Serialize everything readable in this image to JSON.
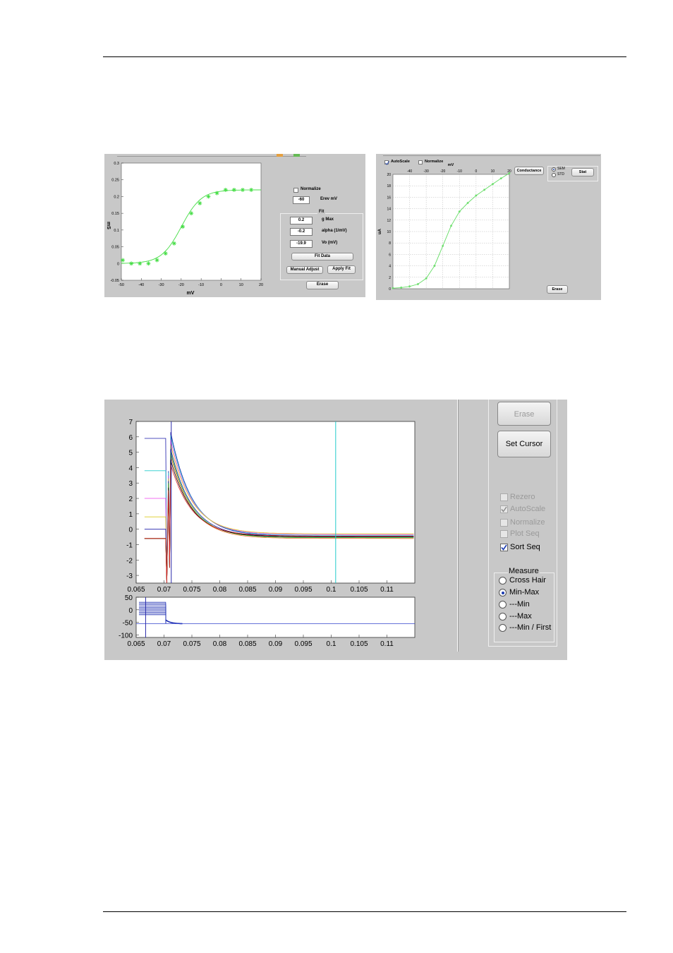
{
  "screenshot_left": {
    "chart_data": {
      "type": "scatter",
      "xlabel": "mV",
      "ylabel": "mS",
      "xlim": [
        -50,
        20
      ],
      "ylim": [
        -0.05,
        0.3
      ],
      "xticks": [
        "-50",
        "-40",
        "-30",
        "-20",
        "-10",
        "0",
        "10",
        "20",
        "30"
      ],
      "yticks": [
        "0.3",
        "0.25",
        "0.2",
        "0.15",
        "0.1",
        "0.05",
        "0",
        "-0.05"
      ],
      "series": [
        {
          "marker": "star",
          "x": [
            -50,
            -45,
            -40,
            -35,
            -30,
            -25,
            -20,
            -15,
            -10,
            -5,
            0,
            5,
            10,
            15,
            20,
            25
          ],
          "y": [
            0.01,
            0.0,
            0.0,
            0.0,
            0.01,
            0.03,
            0.06,
            0.11,
            0.15,
            0.18,
            0.2,
            0.21,
            0.22,
            0.22,
            0.22,
            0.22
          ]
        },
        {
          "marker": "line",
          "fit": true
        }
      ],
      "color": "#44dd44",
      "grid": false
    },
    "normalize_label": "Normalize",
    "erev_value": "-60",
    "erev_label": "Erev mV",
    "fit_group_title": "Fit",
    "gmax_value": "0.2",
    "gmax_label": "g Max",
    "alpha_value": "-0.2",
    "alpha_label": "alpha (1/mV)",
    "vo_value": "-19.9",
    "vo_label": "Vo (mV)",
    "fit_data_button": "Fit Data",
    "manual_adjust_button": "Manual Adjust",
    "apply_fit_button": "Apply Fit",
    "erase_button": "Erase"
  },
  "screenshot_right": {
    "autoscale_label": "AutoScale",
    "normalize_label": "Normalize",
    "chart_data": {
      "type": "line",
      "xlabel": "mV",
      "ylabel": "uA",
      "xlim": [
        -50,
        20
      ],
      "ylim": [
        0,
        20
      ],
      "xticks": [
        "-40",
        "-30",
        "-20",
        "-10",
        "0",
        "10",
        "20"
      ],
      "yticks": [
        "20",
        "18",
        "16",
        "14",
        "12",
        "10",
        "8",
        "6",
        "4",
        "2",
        "0"
      ],
      "x": [
        -50,
        -45,
        -40,
        -35,
        -30,
        -25,
        -20,
        -15,
        -10,
        -5,
        0,
        5,
        10,
        15,
        20
      ],
      "y": [
        0.1,
        0.2,
        0.4,
        0.8,
        1.8,
        4.0,
        7.5,
        11.0,
        13.5,
        15.0,
        16.3,
        17.3,
        18.3,
        19.3,
        20.2
      ],
      "color": "#66dd66",
      "grid": true,
      "axis_position": "top"
    },
    "conductance_button": "Conductance",
    "sem_label": "SEM",
    "std_label": "STD",
    "stat_button": "Stat",
    "erase_button": "Erase"
  },
  "screenshot_bottom": {
    "chart_data": [
      {
        "type": "line",
        "xlim": [
          0.065,
          0.115
        ],
        "ylim": [
          -3.5,
          7
        ],
        "xticks": [
          "0.065",
          "0.07",
          "0.075",
          "0.08",
          "0.085",
          "0.09",
          "0.095",
          "0.1",
          "0.105",
          "0.11"
        ],
        "yticks": [
          "7",
          "6",
          "5",
          "4",
          "3",
          "2",
          "1",
          "0",
          "-1",
          "-2",
          "-3"
        ],
        "series": [
          {
            "color": "#1a1aaa",
            "baseline": 5.9,
            "peak": 6.3,
            "final": -0.45
          },
          {
            "color": "#22cccc",
            "baseline": 3.8,
            "peak": 6.1,
            "final": -0.4
          },
          {
            "color": "#ee44ee",
            "baseline": 2.0,
            "peak": 5.8,
            "final": -0.35
          },
          {
            "color": "#ddcc22",
            "baseline": 0.8,
            "peak": 5.5,
            "final": -0.3
          },
          {
            "color": "#1a1aaa",
            "baseline": 0.0,
            "peak": 5.2,
            "final": -0.5
          },
          {
            "color": "#ee6622",
            "baseline": -0.6,
            "peak": 4.8,
            "final": -0.6
          },
          {
            "color": "#22bb22",
            "baseline": -0.6,
            "peak": 5.0,
            "final": -0.55
          },
          {
            "color": "#000000",
            "baseline": -0.6,
            "peak": 4.5,
            "final": -0.5
          },
          {
            "color": "#dd2222",
            "baseline": -0.6,
            "peak": 4.2,
            "final": -0.45
          }
        ],
        "cursors": [
          {
            "x": 0.0713,
            "color": "#2a2aaa"
          },
          {
            "x": 0.1008,
            "color": "#22cccc"
          }
        ],
        "grid": false
      },
      {
        "type": "line",
        "xlim": [
          0.065,
          0.115
        ],
        "ylim": [
          -110,
          50
        ],
        "xticks": [
          "0.065",
          "0.07",
          "0.075",
          "0.08",
          "0.085",
          "0.09",
          "0.095",
          "0.1",
          "0.105",
          "0.11"
        ],
        "yticks": [
          "50",
          "0",
          "-50",
          "-100"
        ],
        "step_levels": [
          30,
          25,
          20,
          15,
          10,
          5,
          0,
          -5,
          -10,
          -15,
          -20
        ],
        "holding": -55,
        "cursors": [
          {
            "x": 0.0667,
            "color": "#2a2aaa"
          }
        ],
        "color": "#1a2ab0",
        "grid": false
      }
    ],
    "erase_button": "Erase",
    "set_cursor_button": "Set Cursor",
    "checkboxes": [
      {
        "label": "Rezero",
        "checked": false,
        "enabled": false
      },
      {
        "label": "AutoScale",
        "checked": true,
        "enabled": false
      },
      {
        "label": "Normalize",
        "checked": false,
        "enabled": false
      },
      {
        "label": "Plot Seq",
        "checked": false,
        "enabled": false
      },
      {
        "label": "Sort Seq",
        "checked": true,
        "enabled": true
      }
    ],
    "measure_title": "Measure",
    "measure_options": [
      {
        "label": "Cross Hair",
        "selected": false
      },
      {
        "label": "Min-Max",
        "selected": true
      },
      {
        "label": "---Min",
        "selected": false
      },
      {
        "label": "---Max",
        "selected": false
      },
      {
        "label": "---Min / First",
        "selected": false
      }
    ]
  }
}
